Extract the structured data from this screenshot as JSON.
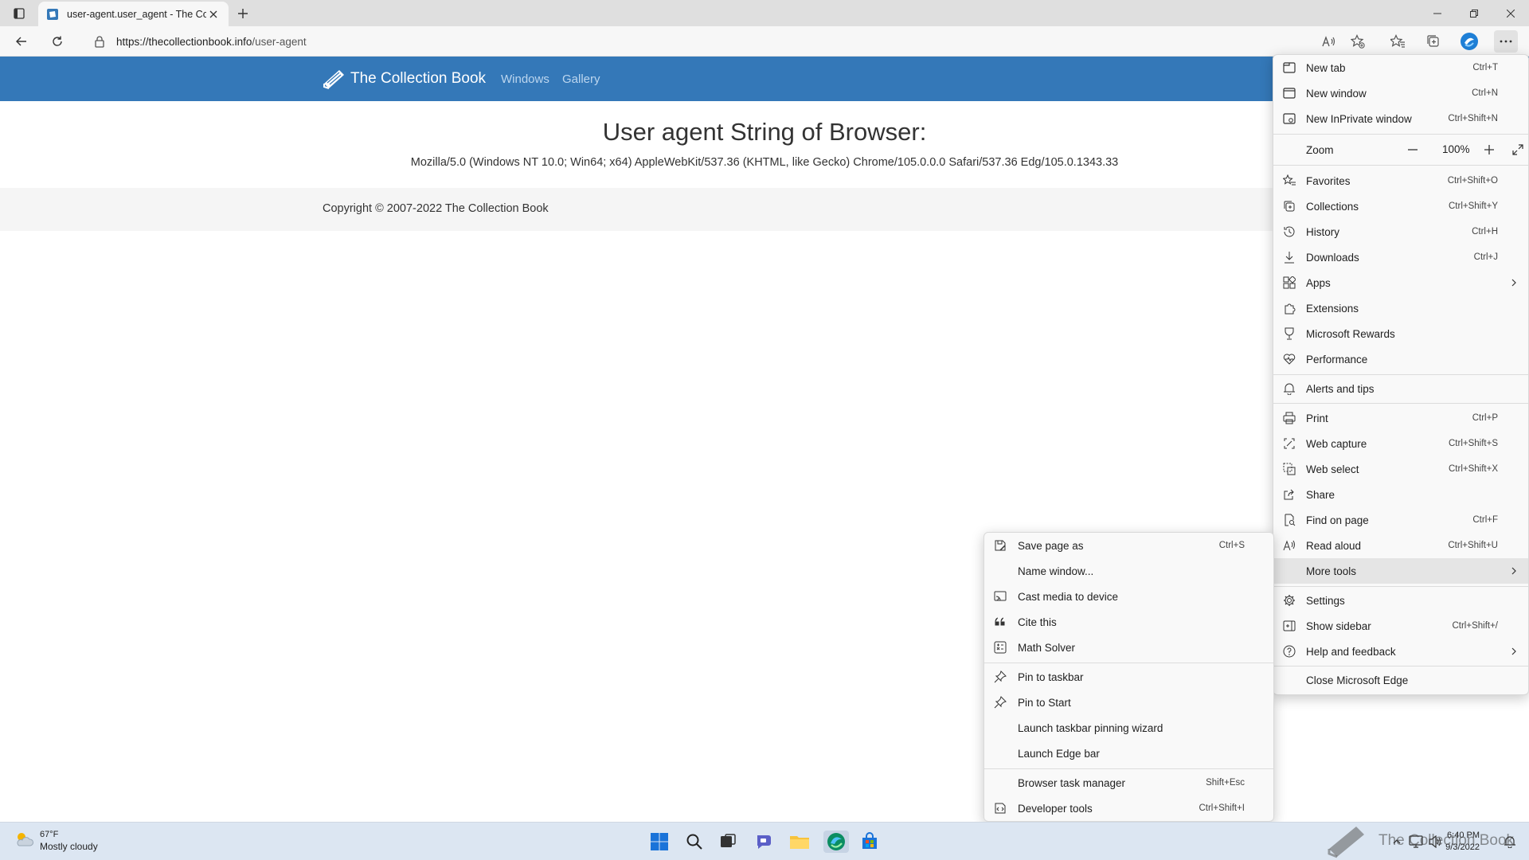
{
  "browser": {
    "tab_title": "user-agent.user_agent - The Collection Book",
    "url_host": "https://thecollectionbook.info",
    "url_path": "/user-agent"
  },
  "site": {
    "brand": "The Collection Book",
    "nav": [
      "Windows",
      "Gallery"
    ],
    "headline": "User agent String of Browser:",
    "user_agent": "Mozilla/5.0 (Windows NT 10.0; Win64; x64) AppleWebKit/537.36 (KHTML, like Gecko) Chrome/105.0.0.0 Safari/537.36 Edg/105.0.1343.33",
    "copyright": "Copyright © 2007-2022 The Collection Book"
  },
  "main_menu": {
    "items": [
      {
        "label": "New tab",
        "shortcut": "Ctrl+T",
        "icon": "new-tab-icon"
      },
      {
        "label": "New window",
        "shortcut": "Ctrl+N",
        "icon": "new-window-icon"
      },
      {
        "label": "New InPrivate window",
        "shortcut": "Ctrl+Shift+N",
        "icon": "inprivate-icon"
      },
      {
        "label": "Zoom",
        "value": "100%"
      },
      {
        "label": "Favorites",
        "shortcut": "Ctrl+Shift+O",
        "icon": "favorites-icon"
      },
      {
        "label": "Collections",
        "shortcut": "Ctrl+Shift+Y",
        "icon": "collections-icon"
      },
      {
        "label": "History",
        "shortcut": "Ctrl+H",
        "icon": "history-icon"
      },
      {
        "label": "Downloads",
        "shortcut": "Ctrl+J",
        "icon": "downloads-icon"
      },
      {
        "label": "Apps",
        "icon": "apps-icon"
      },
      {
        "label": "Extensions",
        "icon": "extensions-icon"
      },
      {
        "label": "Microsoft Rewards",
        "icon": "rewards-icon"
      },
      {
        "label": "Performance",
        "icon": "performance-icon"
      },
      {
        "label": "Alerts and tips",
        "icon": "bell-icon"
      },
      {
        "label": "Print",
        "shortcut": "Ctrl+P",
        "icon": "print-icon"
      },
      {
        "label": "Web capture",
        "shortcut": "Ctrl+Shift+S",
        "icon": "web-capture-icon"
      },
      {
        "label": "Web select",
        "shortcut": "Ctrl+Shift+X",
        "icon": "web-select-icon"
      },
      {
        "label": "Share",
        "icon": "share-icon"
      },
      {
        "label": "Find on page",
        "shortcut": "Ctrl+F",
        "icon": "find-icon"
      },
      {
        "label": "Read aloud",
        "shortcut": "Ctrl+Shift+U",
        "icon": "read-aloud-icon"
      },
      {
        "label": "More tools"
      },
      {
        "label": "Settings",
        "icon": "gear-icon"
      },
      {
        "label": "Show sidebar",
        "shortcut": "Ctrl+Shift+/",
        "icon": "sidebar-icon"
      },
      {
        "label": "Help and feedback",
        "icon": "help-icon"
      },
      {
        "label": "Close Microsoft Edge"
      }
    ]
  },
  "more_tools": {
    "items": [
      {
        "label": "Save page as",
        "shortcut": "Ctrl+S",
        "icon": "save-icon"
      },
      {
        "label": "Name window...",
        "shortcut": ""
      },
      {
        "label": "Cast media to device",
        "shortcut": "",
        "icon": "cast-icon"
      },
      {
        "label": "Cite this",
        "shortcut": "",
        "icon": "quote-icon"
      },
      {
        "label": "Math Solver",
        "shortcut": "",
        "icon": "math-icon"
      },
      {
        "label": "Pin to taskbar",
        "shortcut": "",
        "icon": "pin-icon"
      },
      {
        "label": "Pin to Start",
        "shortcut": "",
        "icon": "pin-icon"
      },
      {
        "label": "Launch taskbar pinning wizard",
        "shortcut": ""
      },
      {
        "label": "Launch Edge bar",
        "shortcut": ""
      },
      {
        "label": "Browser task manager",
        "shortcut": "Shift+Esc"
      },
      {
        "label": "Developer tools",
        "shortcut": "Ctrl+Shift+I",
        "icon": "devtools-icon"
      }
    ]
  },
  "taskbar": {
    "temp": "67°F",
    "condition": "Mostly cloudy",
    "time": "6:40 PM",
    "date": "9/3/2022",
    "watermark": "The Collection Book"
  }
}
